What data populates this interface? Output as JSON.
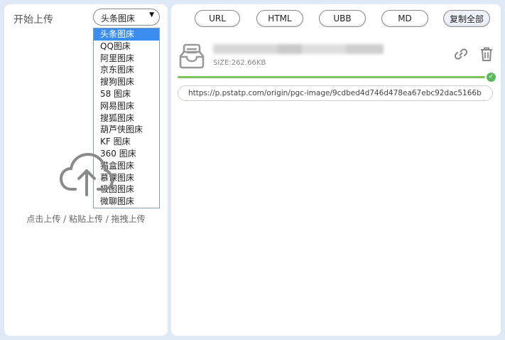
{
  "left": {
    "title": "开始上传",
    "select": {
      "value": "头条图床"
    },
    "options": [
      "头条图床",
      "QQ图床",
      "阿里图床",
      "京东图床",
      "搜狗图床",
      "58 图床",
      "网易图床",
      "搜狐图床",
      "葫芦侠图床",
      "KF 图床",
      "360 图床",
      "猫盒图床",
      "慕课图床",
      "极图图床",
      "微聊图床"
    ],
    "upload_hint": "点击上传 / 粘贴上传 / 拖拽上传"
  },
  "toolbar": {
    "url": "URL",
    "html": "HTML",
    "ubb": "UBB",
    "md": "MD",
    "copy_all": "复制全部"
  },
  "file": {
    "size": "SIZE:262.66KB",
    "progress": 1.0,
    "url": "https://p.pstatp.com/origin/pgc-image/9cdbed4d746d478ea67ebc92dac5166b"
  },
  "icons": {
    "upload": "cloud-upload-icon",
    "file": "inbox-file-icon",
    "copy_link": "link-icon",
    "delete": "trash-icon",
    "done": "check-circle-icon"
  },
  "colors": {
    "selected_option": "#3b8ef0",
    "progress": "#7cc35b",
    "success": "#5cb85c"
  }
}
